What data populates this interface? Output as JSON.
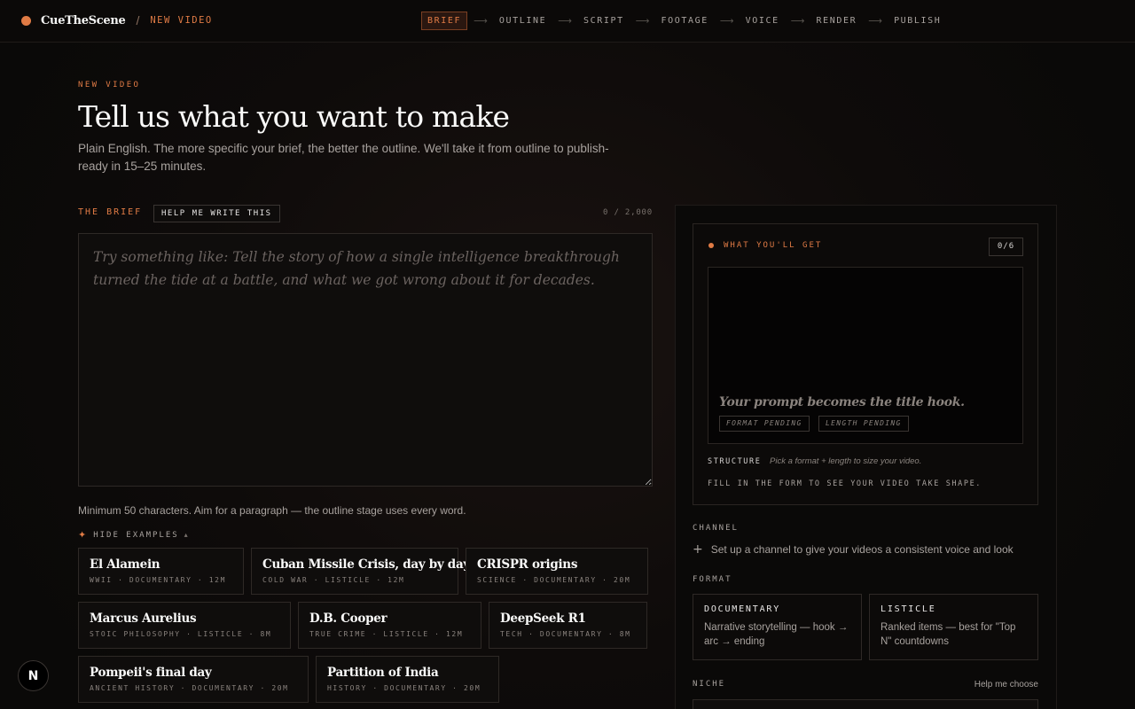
{
  "brand": {
    "name": "CueTheScene",
    "separator": "/",
    "crumb": "NEW VIDEO"
  },
  "steps": [
    "BRIEF",
    "OUTLINE",
    "SCRIPT",
    "FOOTAGE",
    "VOICE",
    "RENDER",
    "PUBLISH"
  ],
  "active_step": "BRIEF",
  "header": {
    "eyebrow": "NEW VIDEO",
    "title": "Tell us what you want to make",
    "subtitle": "Plain English. The more specific your brief, the better the outline. We'll take it from outline to publish-ready in 15–25 minutes."
  },
  "brief": {
    "label": "THE BRIEF",
    "help_button": "HELP ME WRITE THIS",
    "char_count": "0 / 2,000",
    "value": "",
    "placeholder": "Try something like: Tell the story of how a single intelligence breakthrough turned the tide at a battle, and what we got wrong about it for decades.",
    "hint": "Minimum 50 characters. Aim for a paragraph — the outline stage uses every word."
  },
  "examples": {
    "toggle_label": "HIDE EXAMPLES",
    "items": [
      {
        "title": "El Alamein",
        "meta": "WWII · DOCUMENTARY · 12M"
      },
      {
        "title": "Cuban Missile Crisis, day by day",
        "meta": "COLD WAR · LISTICLE · 12M"
      },
      {
        "title": "CRISPR origins",
        "meta": "SCIENCE · DOCUMENTARY · 20M"
      },
      {
        "title": "Marcus Aurelius",
        "meta": "STOIC PHILOSOPHY · LISTICLE · 8M"
      },
      {
        "title": "D.B. Cooper",
        "meta": "TRUE CRIME · LISTICLE · 12M"
      },
      {
        "title": "DeepSeek R1",
        "meta": "TECH · DOCUMENTARY · 8M"
      },
      {
        "title": "Pompeii's final day",
        "meta": "ANCIENT HISTORY · DOCUMENTARY · 20M"
      },
      {
        "title": "Partition of India",
        "meta": "HISTORY · DOCUMENTARY · 20M"
      }
    ]
  },
  "preview": {
    "label": "WHAT YOU'LL GET",
    "count": "0/6",
    "hook": "Your prompt becomes the title hook.",
    "pills": [
      "FORMAT PENDING",
      "LENGTH PENDING"
    ],
    "structure_label": "STRUCTURE",
    "structure_text": "Pick a format + length to size your video.",
    "fill_text": "FILL IN THE FORM TO SEE YOUR VIDEO TAKE SHAPE."
  },
  "channel": {
    "label": "CHANNEL",
    "link": "Set up a channel to give your videos a consistent voice and look"
  },
  "format": {
    "label": "FORMAT",
    "options": [
      {
        "title": "DOCUMENTARY",
        "desc": "Narrative storytelling — hook → arc → ending"
      },
      {
        "title": "LISTICLE",
        "desc": "Ranked items — best for \"Top N\" countdowns"
      }
    ]
  },
  "niche": {
    "label": "NICHE",
    "help": "Help me choose"
  },
  "dev_badge": {
    "letter": "N"
  },
  "colors": {
    "accent": "#e07b45",
    "background": "#0c0a09",
    "border": "#2e2926"
  }
}
